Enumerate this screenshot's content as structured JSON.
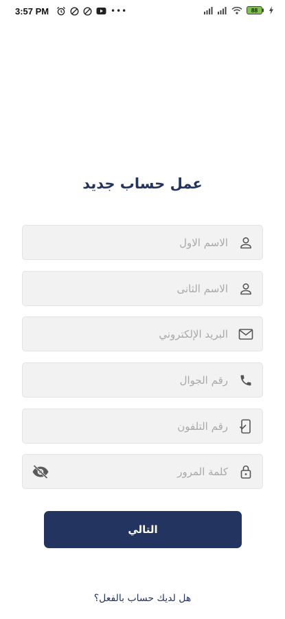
{
  "status_bar": {
    "time": "3:57 PM",
    "more_indicator": "•••",
    "battery": "88"
  },
  "form": {
    "title": "عمل حساب جديد",
    "fields": {
      "first_name": {
        "placeholder": "الاسم الاول",
        "icon": "user-icon"
      },
      "last_name": {
        "placeholder": "الاسم الثانى",
        "icon": "user-icon"
      },
      "email": {
        "placeholder": "البريد الإلكتروني",
        "icon": "mail-icon"
      },
      "mobile": {
        "placeholder": "رقم الجوال",
        "icon": "phone-icon"
      },
      "telephone": {
        "placeholder": "رقم التلفون",
        "icon": "mobile-check-icon"
      },
      "password": {
        "placeholder": "كلمة المرور",
        "icon": "lock-icon",
        "toggle_icon": "eye-off-icon"
      }
    },
    "next_label": "التالي",
    "login_prompt": "هل لديك حساب بالفعل؟"
  },
  "colors": {
    "primary": "#243461",
    "field_bg": "#f2f2f2",
    "placeholder": "#a9a9a9"
  }
}
